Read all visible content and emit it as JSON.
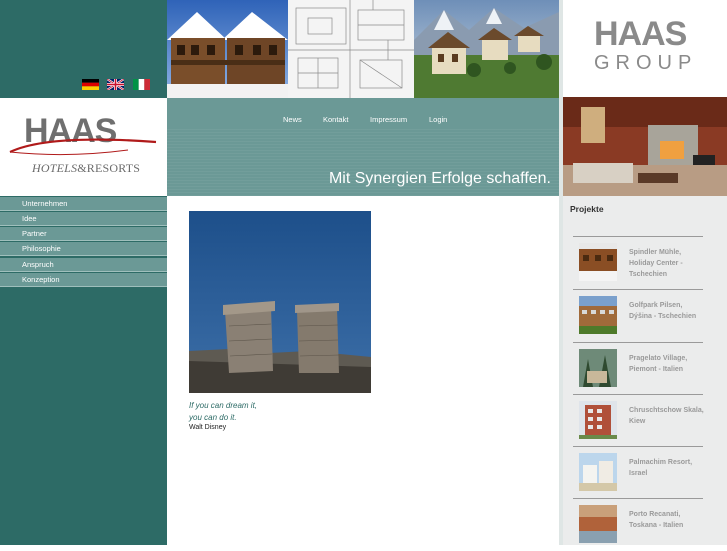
{
  "languages": [
    {
      "name": "german-flag"
    },
    {
      "name": "uk-flag"
    },
    {
      "name": "italian-flag"
    }
  ],
  "hotels_logo": {
    "brand": "HAAS",
    "tagline_left": "HOTELS",
    "tagline_amp": "&",
    "tagline_right": "RESORTS"
  },
  "group_logo": {
    "brand": "HAAS",
    "sub": "GROUP"
  },
  "top_nav": {
    "items": [
      "News",
      "Kontakt",
      "Impressum",
      "Login"
    ]
  },
  "slogan": "Mit Synergien Erfolge schaffen.",
  "side_nav": {
    "items": [
      "Unternehmen",
      "Idee",
      "Partner",
      "Philosophie",
      "Anspruch",
      "Konzeption"
    ]
  },
  "quote": {
    "line1": "If you can dream it,",
    "line2": "you can do it.",
    "author": "Walt Disney"
  },
  "projects": {
    "title": "Projekte",
    "items": [
      {
        "label": "Spindler Mühle, Holiday Center - Tschechien"
      },
      {
        "label": "Golfpark Pilsen, Dýšina - Tschechien"
      },
      {
        "label": "Pragelato Village, Piemont - Italien"
      },
      {
        "label": "Chruschtschow Skala, Kiew"
      },
      {
        "label": "Palmachim Resort, Israel"
      },
      {
        "label": "Porto Recanati, Toskana - Italien"
      }
    ]
  },
  "colors": {
    "teal_dark": "#2d6b66",
    "teal_mid": "#6b9996",
    "panel_grey": "#ebecec",
    "project_text": "#9a9a9a"
  }
}
